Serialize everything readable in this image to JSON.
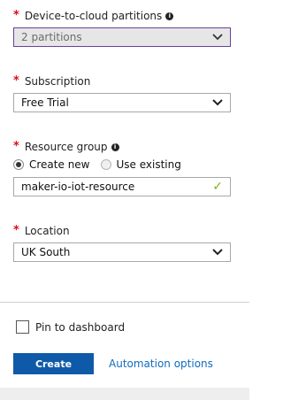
{
  "partitions": {
    "label": "Device-to-cloud partitions",
    "value": "2 partitions"
  },
  "subscription": {
    "label": "Subscription",
    "value": "Free Trial"
  },
  "resource_group": {
    "label": "Resource group",
    "option_new": "Create new",
    "option_existing": "Use existing",
    "selected": "Create new",
    "value": "maker-io-iot-resource"
  },
  "location": {
    "label": "Location",
    "value": "UK South"
  },
  "pin": {
    "label": "Pin to dashboard",
    "checked": false
  },
  "actions": {
    "create_label": "Create",
    "automation_label": "Automation options"
  },
  "colors": {
    "required": "#e00b1c",
    "primary": "#0f5aa8",
    "link": "#0f6cbd",
    "valid": "#7bb21f",
    "focus_border": "#6b3fa0"
  },
  "icons": {
    "required": "asterisk",
    "info": "info-icon",
    "chevron": "chevron-down-icon",
    "valid": "checkmark-icon"
  }
}
